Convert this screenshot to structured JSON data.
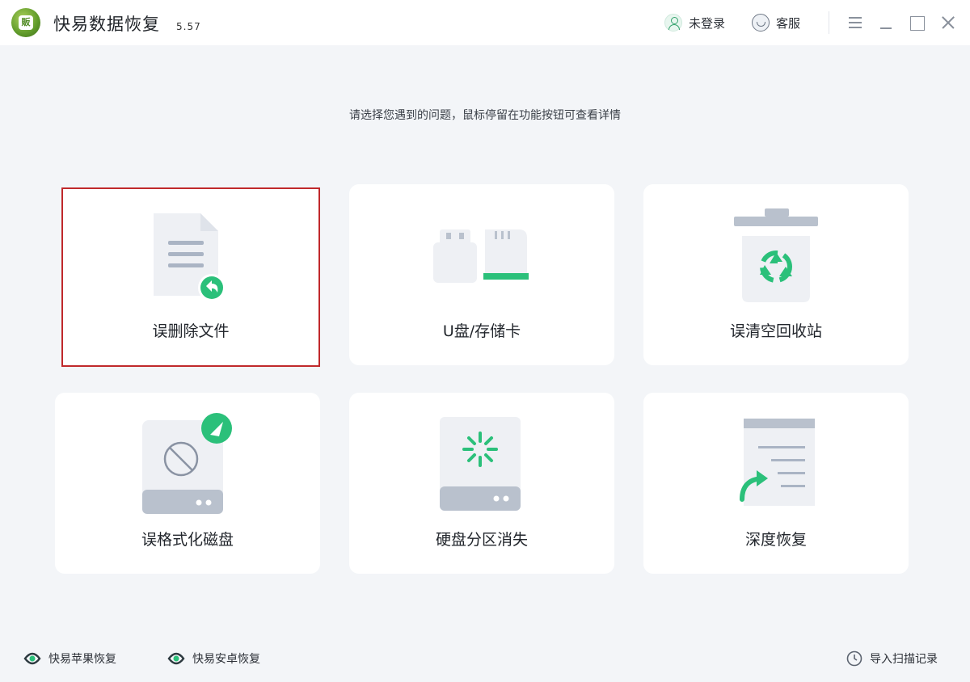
{
  "app": {
    "logo_text": "販",
    "title": "快易数据恢复",
    "version": "5.57"
  },
  "header": {
    "login_label": "未登录",
    "service_label": "客服"
  },
  "hint": "请选择您遇到的问题，鼠标停留在功能按钮可查看详情",
  "cards": [
    {
      "label": "误删除文件",
      "icon": "document-restore-icon"
    },
    {
      "label": "U盘/存储卡",
      "icon": "usb-sdcard-icon"
    },
    {
      "label": "误清空回收站",
      "icon": "recycle-bin-icon"
    },
    {
      "label": "误格式化磁盘",
      "icon": "formatted-disk-icon"
    },
    {
      "label": "硬盘分区消失",
      "icon": "partition-loading-icon"
    },
    {
      "label": "深度恢复",
      "icon": "deep-recovery-icon"
    }
  ],
  "footer": {
    "apple_label": "快易苹果恢复",
    "android_label": "快易安卓恢复",
    "import_label": "导入扫描记录"
  },
  "colors": {
    "accent": "#2bc07a",
    "selected_border": "#c0292b",
    "background": "#f3f5f8"
  }
}
